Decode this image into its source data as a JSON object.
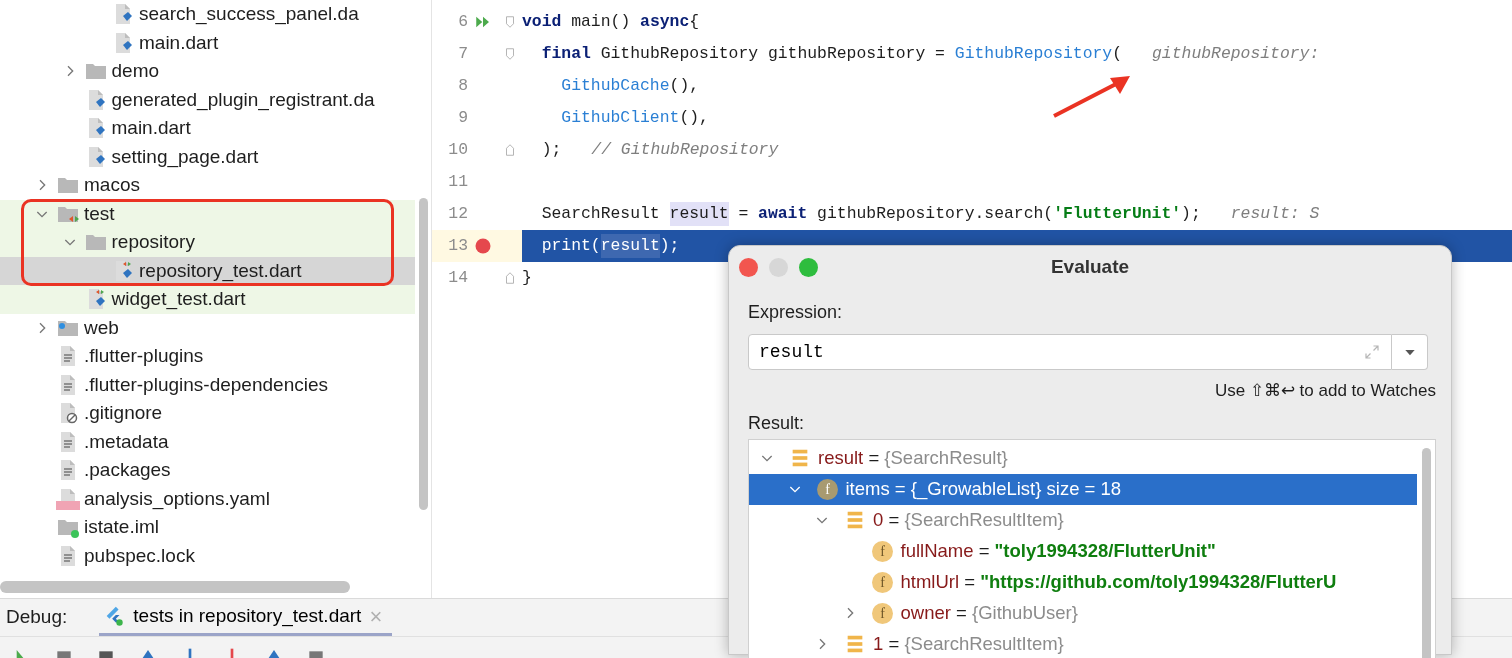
{
  "project_tree": {
    "items": [
      {
        "children": [
          {
            "children": [
              {
                "label": "search_success_panel.da",
                "kind": "dart",
                "selected": false
              },
              {
                "label": "main.dart",
                "kind": "dart",
                "selected": false
              }
            ]
          },
          {
            "label": "demo",
            "kind": "folder",
            "selected": false,
            "expanded": false
          },
          {
            "label": "generated_plugin_registrant.da",
            "kind": "dart",
            "selected": false
          },
          {
            "label": "main.dart",
            "kind": "dart",
            "selected": false
          },
          {
            "label": "setting_page.dart",
            "kind": "dart",
            "selected": false
          }
        ]
      },
      {
        "label": "macos",
        "kind": "folder",
        "selected": false,
        "expanded": false
      },
      {
        "label": "test",
        "kind": "test-folder",
        "selected": false,
        "expanded": true,
        "children": [
          {
            "label": "repository",
            "kind": "folder",
            "selected": false,
            "expanded": true,
            "children": [
              {
                "label": "repository_test.dart",
                "kind": "test-dart",
                "selected": true
              }
            ]
          },
          {
            "label": "widget_test.dart",
            "kind": "test-dart",
            "selected": false
          }
        ]
      },
      {
        "label": "web",
        "kind": "web-folder",
        "selected": false,
        "expanded": false
      },
      {
        "label": ".flutter-plugins",
        "kind": "text",
        "selected": false
      },
      {
        "label": ".flutter-plugins-dependencies",
        "kind": "text",
        "selected": false
      },
      {
        "label": ".gitignore",
        "kind": "ignore",
        "selected": false
      },
      {
        "label": ".metadata",
        "kind": "text",
        "selected": false
      },
      {
        "label": ".packages",
        "kind": "text",
        "selected": false
      },
      {
        "label": "analysis_options.yaml",
        "kind": "yaml",
        "selected": false
      },
      {
        "label": "istate.iml",
        "kind": "module",
        "selected": false
      },
      {
        "label": "pubspec.lock",
        "kind": "text",
        "selected": false
      }
    ]
  },
  "editor": {
    "lines": [
      {
        "number": "6",
        "run": true,
        "fold_start": true,
        "fold_end": false,
        "breakpoint": false,
        "current": false,
        "tokens": [
          {
            "kind": "keyword",
            "text": "void"
          },
          {
            "kind": "plain",
            "text": " main() "
          },
          {
            "kind": "keyword",
            "text": "async"
          },
          {
            "kind": "plain",
            "text": "{"
          }
        ]
      },
      {
        "number": "7",
        "run": false,
        "fold_start": true,
        "fold_end": false,
        "breakpoint": false,
        "current": false,
        "tokens": [
          {
            "kind": "keyword",
            "text": "  final"
          },
          {
            "kind": "plain",
            "text": " GithubRepository githubRepository = "
          },
          {
            "kind": "ctor",
            "text": "GithubRepository"
          },
          {
            "kind": "plain",
            "text": "("
          },
          {
            "kind": "hint",
            "text": "githubRepository:"
          }
        ]
      },
      {
        "number": "8",
        "run": false,
        "fold_start": false,
        "fold_end": false,
        "breakpoint": false,
        "current": false,
        "tokens": [
          {
            "kind": "ctor",
            "text": "    GithubCache"
          },
          {
            "kind": "plain",
            "text": "(),"
          }
        ]
      },
      {
        "number": "9",
        "run": false,
        "fold_start": false,
        "fold_end": false,
        "breakpoint": false,
        "current": false,
        "tokens": [
          {
            "kind": "ctor",
            "text": "    GithubClient"
          },
          {
            "kind": "plain",
            "text": "(),"
          }
        ]
      },
      {
        "number": "10",
        "run": false,
        "fold_start": false,
        "fold_end": true,
        "breakpoint": false,
        "current": false,
        "tokens": [
          {
            "kind": "plain",
            "text": "  );"
          },
          {
            "kind": "hint",
            "text": "// GithubRepository"
          }
        ]
      },
      {
        "number": "11",
        "run": false,
        "fold_start": false,
        "fold_end": false,
        "breakpoint": false,
        "current": false
      },
      {
        "number": "12",
        "run": false,
        "fold_start": false,
        "fold_end": false,
        "breakpoint": false,
        "current": false,
        "tokens": [
          {
            "kind": "plain",
            "text": "  SearchResult "
          },
          {
            "kind": "usage",
            "text": "result"
          },
          {
            "kind": "plain",
            "text": " = "
          },
          {
            "kind": "keyword",
            "text": "await"
          },
          {
            "kind": "plain",
            "text": " githubRepository.search("
          },
          {
            "kind": "string",
            "text": "'FlutterUnit'"
          },
          {
            "kind": "plain",
            "text": ");"
          },
          {
            "kind": "hint",
            "text": "result: S"
          }
        ]
      },
      {
        "number": "13",
        "run": false,
        "fold_start": false,
        "fold_end": false,
        "breakpoint": true,
        "current": true,
        "tokens": [
          {
            "kind": "plain",
            "text": "  print("
          },
          {
            "kind": "usage",
            "text": "result"
          },
          {
            "kind": "plain",
            "text": ");"
          }
        ]
      },
      {
        "number": "14",
        "run": false,
        "fold_start": false,
        "fold_end": true,
        "breakpoint": false,
        "current": false,
        "tokens": [
          {
            "kind": "plain",
            "text": "}"
          }
        ]
      }
    ]
  },
  "evaluate_dialog": {
    "title": "Evaluate",
    "expression_label": "Expression:",
    "expression": "result",
    "watch_hint": "Use ⇧⌘↩ to add to Watches",
    "result_label": "Result:",
    "result_tree": [
      {
        "kind": "object",
        "name": "result",
        "op": "=",
        "value": "{SearchResult}",
        "string_value": false,
        "selected": false,
        "expanded": true,
        "children": [
          {
            "kind": "field",
            "icon_letter": "f",
            "name": "items",
            "op": "=",
            "value": "{_GrowableList} size = 18",
            "string_value": false,
            "selected": true,
            "expanded": true,
            "children": [
              {
                "kind": "object",
                "name": "0",
                "op": "=",
                "value": "{SearchResultItem}",
                "string_value": false,
                "selected": false,
                "expanded": true,
                "children": [
                  {
                    "kind": "field",
                    "icon_letter": "f",
                    "name": "fullName",
                    "op": "=",
                    "value": "\"toly1994328/FlutterUnit\"",
                    "string_value": true,
                    "selected": false
                  },
                  {
                    "kind": "field",
                    "icon_letter": "f",
                    "name": "htmlUrl",
                    "op": "=",
                    "value": "\"https://github.com/toly1994328/FlutterU",
                    "string_value": true,
                    "selected": false
                  },
                  {
                    "kind": "field",
                    "icon_letter": "f",
                    "name": "owner",
                    "op": "=",
                    "value": "{GithubUser}",
                    "string_value": false,
                    "selected": false,
                    "expanded": false
                  }
                ]
              },
              {
                "kind": "object",
                "name": "1",
                "op": "=",
                "value": "{SearchResultItem}",
                "string_value": false,
                "selected": false,
                "expanded": false
              }
            ]
          }
        ]
      }
    ]
  },
  "debug_bar": {
    "label": "Debug:",
    "tabs": [
      {
        "label": "tests in repository_test.dart",
        "selected": true,
        "close": "×"
      }
    ]
  }
}
